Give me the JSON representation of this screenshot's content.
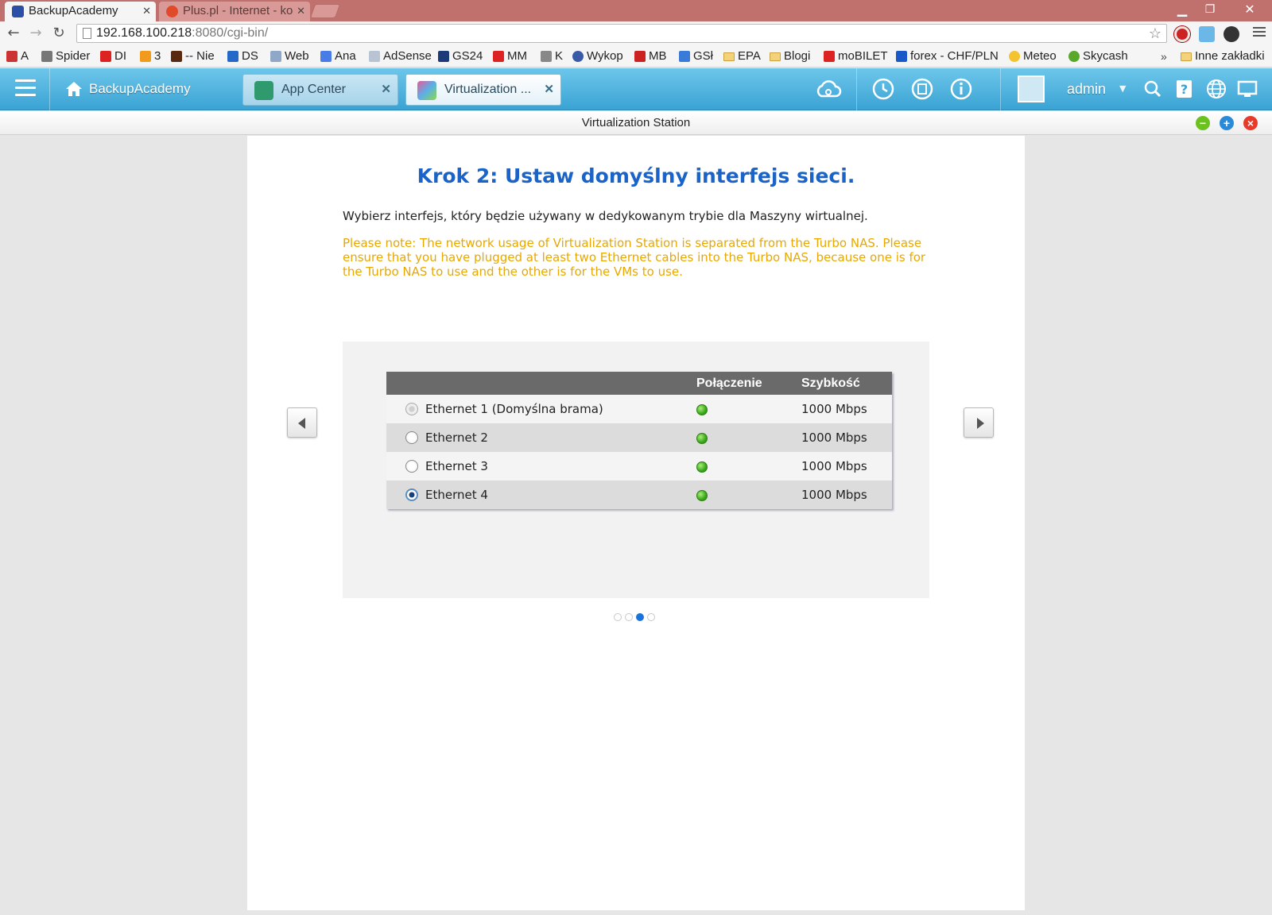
{
  "browser": {
    "tabs": [
      {
        "title": "BackupAcademy",
        "active": true
      },
      {
        "title": "Plus.pl - Internet - ko",
        "active": false
      }
    ],
    "url_host": "192.168.100.218",
    "url_rest": ":8080/cgi-bin/",
    "bookmarks": [
      "A",
      "Spider",
      "DI",
      "3",
      "-- Nie",
      "DS",
      "Web",
      "Ana",
      "AdSense",
      "GS24",
      "MM",
      "K",
      "Wykop",
      "MB",
      "GSł",
      "EPA",
      "Blogi",
      "moBILET",
      "forex - CHF/PLN",
      "Meteo",
      "Skycash"
    ],
    "bookmarks_more": "»",
    "other_bookmarks": "Inne zakładki"
  },
  "qnap": {
    "home_label": "BackupAcademy",
    "app_tabs": [
      {
        "label": "App Center",
        "active": false
      },
      {
        "label": "Virtualization ...",
        "active": true
      }
    ],
    "user": "admin"
  },
  "window": {
    "title": "Virtualization Station"
  },
  "wizard": {
    "title": "Krok 2: Ustaw domyślny interfejs sieci.",
    "description": "Wybierz interfejs, który będzie używany w dedykowanym trybie dla Maszyny wirtualnej.",
    "note": "Please note: The network usage of Virtualization Station is separated from the Turbo NAS. Please ensure that you have plugged at least two Ethernet cables into the Turbo NAS, because one is for the Turbo NAS to use and the other is for the VMs to use.",
    "table": {
      "headers": [
        "",
        "Połączenie",
        "Szybkość"
      ],
      "rows": [
        {
          "name": "Ethernet 1 (Domyślna brama)",
          "state": "disabled",
          "connected": true,
          "speed": "1000 Mbps"
        },
        {
          "name": "Ethernet 2",
          "state": "unchecked",
          "connected": true,
          "speed": "1000 Mbps"
        },
        {
          "name": "Ethernet 3",
          "state": "unchecked",
          "connected": true,
          "speed": "1000 Mbps"
        },
        {
          "name": "Ethernet 4",
          "state": "checked",
          "connected": true,
          "speed": "1000 Mbps"
        }
      ]
    },
    "pager": {
      "pages": 4,
      "current": 3
    }
  },
  "colors": {
    "title_blue": "#1a63c8",
    "note_orange": "#e8a800",
    "header_blue": "#3aa3d4",
    "status_green": "#3aa81a"
  }
}
